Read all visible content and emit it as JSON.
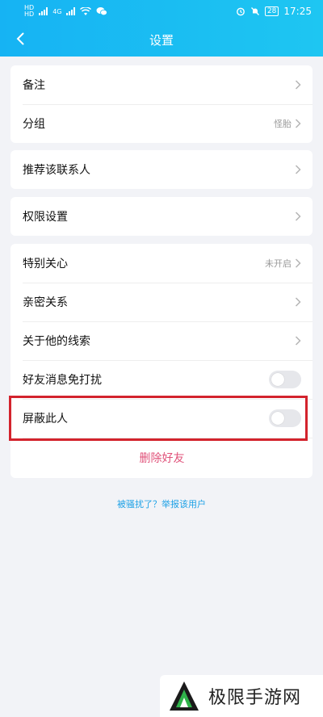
{
  "status_bar": {
    "sim1": "HD",
    "sim2": "HD",
    "network": "4G",
    "battery": "28",
    "time": "17:25"
  },
  "nav": {
    "title": "设置"
  },
  "section_1": [
    {
      "label": "备注",
      "value": ""
    },
    {
      "label": "分组",
      "value": "怪胎"
    }
  ],
  "section_2": [
    {
      "label": "推荐该联系人"
    }
  ],
  "section_3": [
    {
      "label": "权限设置"
    }
  ],
  "section_4": [
    {
      "label": "特别关心",
      "value": "未开启"
    },
    {
      "label": "亲密关系"
    },
    {
      "label": "关于他的线索"
    },
    {
      "label": "好友消息免打扰",
      "toggle_on": false
    },
    {
      "label": "屏蔽此人",
      "toggle_on": false
    }
  ],
  "delete": {
    "label": "删除好友"
  },
  "report": {
    "label": "被骚扰了？举报该用户"
  },
  "watermark": {
    "text": "极限手游网"
  },
  "colors": {
    "header_start": "#16b3f3",
    "header_end": "#1ec6f2",
    "delete": "#e0527a",
    "link": "#1da1e6",
    "highlight": "#d3232d"
  }
}
